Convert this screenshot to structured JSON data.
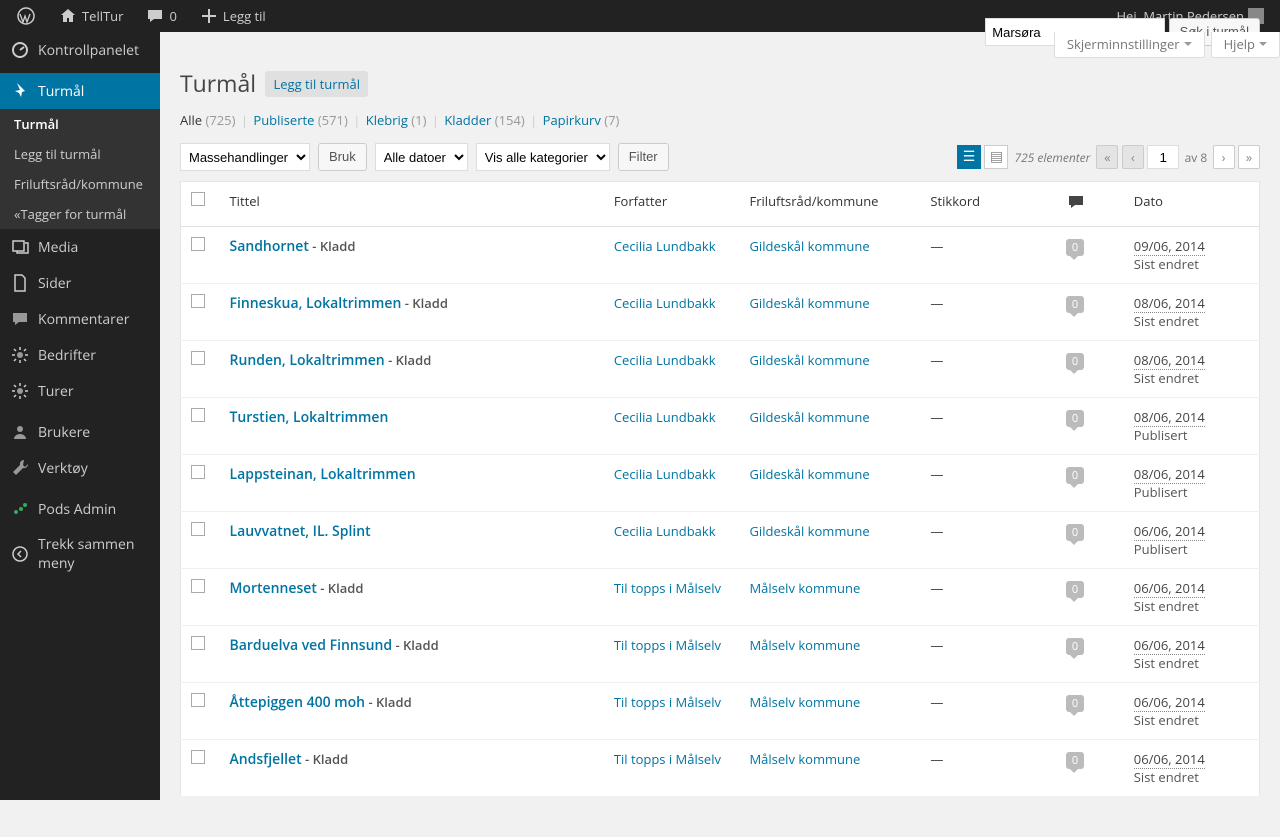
{
  "adminbar": {
    "site": "TellTur",
    "comments": "0",
    "new": "Legg til",
    "greeting": "Hei, Martin Pedersen"
  },
  "sidebar": {
    "dashboard": "Kontrollpanelet",
    "turmal": "Turmål",
    "sub": {
      "turmal": "Turmål",
      "add": "Legg til turmål",
      "fr": "Friluftsråd/kommune",
      "tags": "«Tagger for turmål"
    },
    "media": "Media",
    "pages": "Sider",
    "comments": "Kommentarer",
    "bedrifter": "Bedrifter",
    "turer": "Turer",
    "users": "Brukere",
    "tools": "Verktøy",
    "pods": "Pods Admin",
    "collapse": "Trekk sammen meny"
  },
  "screen_meta": {
    "screen_options": "Skjerminnstillinger",
    "help": "Hjelp"
  },
  "heading": "Turmål",
  "add_new": "Legg til turmål",
  "filters": {
    "all": "Alle",
    "all_count": "(725)",
    "published": "Publiserte",
    "published_count": "(571)",
    "sticky": "Klebrig",
    "sticky_count": "(1)",
    "drafts": "Kladder",
    "drafts_count": "(154)",
    "trash": "Papirkurv",
    "trash_count": "(7)"
  },
  "search": {
    "value": "Marsøra",
    "button": "Søk i turmål"
  },
  "bulk": {
    "actions": "Massehandlinger",
    "apply": "Bruk",
    "dates": "Alle datoer",
    "cats": "Vis alle kategorier",
    "filter": "Filter"
  },
  "nav": {
    "count_label": "725 elementer",
    "page": "1",
    "of": "av 8"
  },
  "columns": {
    "title": "Tittel",
    "author": "Forfatter",
    "cat": "Friluftsråd/kommune",
    "tags": "Stikkord",
    "date": "Dato"
  },
  "rows": [
    {
      "title": "Sandhornet",
      "state": " - Kladd",
      "author": "Cecilia Lundbakk",
      "cat": "Gildeskål kommune",
      "tags": "—",
      "comments": "0",
      "date": "09/06, 2014",
      "status": "Sist endret"
    },
    {
      "title": "Finneskua, Lokaltrimmen",
      "state": " - Kladd",
      "author": "Cecilia Lundbakk",
      "cat": "Gildeskål kommune",
      "tags": "—",
      "comments": "0",
      "date": "08/06, 2014",
      "status": "Sist endret"
    },
    {
      "title": "Runden, Lokaltrimmen",
      "state": " - Kladd",
      "author": "Cecilia Lundbakk",
      "cat": "Gildeskål kommune",
      "tags": "—",
      "comments": "0",
      "date": "08/06, 2014",
      "status": "Sist endret"
    },
    {
      "title": "Turstien, Lokaltrimmen",
      "state": "",
      "author": "Cecilia Lundbakk",
      "cat": "Gildeskål kommune",
      "tags": "—",
      "comments": "0",
      "date": "08/06, 2014",
      "status": "Publisert"
    },
    {
      "title": "Lappsteinan, Lokaltrimmen",
      "state": "",
      "author": "Cecilia Lundbakk",
      "cat": "Gildeskål kommune",
      "tags": "—",
      "comments": "0",
      "date": "08/06, 2014",
      "status": "Publisert"
    },
    {
      "title": "Lauvvatnet, IL. Splint",
      "state": "",
      "author": "Cecilia Lundbakk",
      "cat": "Gildeskål kommune",
      "tags": "—",
      "comments": "0",
      "date": "06/06, 2014",
      "status": "Publisert"
    },
    {
      "title": "Mortenneset",
      "state": " - Kladd",
      "author": "Til topps i Målselv",
      "cat": "Målselv kommune",
      "tags": "—",
      "comments": "0",
      "date": "06/06, 2014",
      "status": "Sist endret"
    },
    {
      "title": "Barduelva ved Finnsund",
      "state": " - Kladd",
      "author": "Til topps i Målselv",
      "cat": "Målselv kommune",
      "tags": "—",
      "comments": "0",
      "date": "06/06, 2014",
      "status": "Sist endret"
    },
    {
      "title": "Åttepiggen 400 moh",
      "state": " - Kladd",
      "author": "Til topps i Målselv",
      "cat": "Målselv kommune",
      "tags": "—",
      "comments": "0",
      "date": "06/06, 2014",
      "status": "Sist endret"
    },
    {
      "title": "Andsfjellet",
      "state": " - Kladd",
      "author": "Til topps i Målselv",
      "cat": "Målselv kommune",
      "tags": "—",
      "comments": "0",
      "date": "06/06, 2014",
      "status": "Sist endret"
    }
  ]
}
